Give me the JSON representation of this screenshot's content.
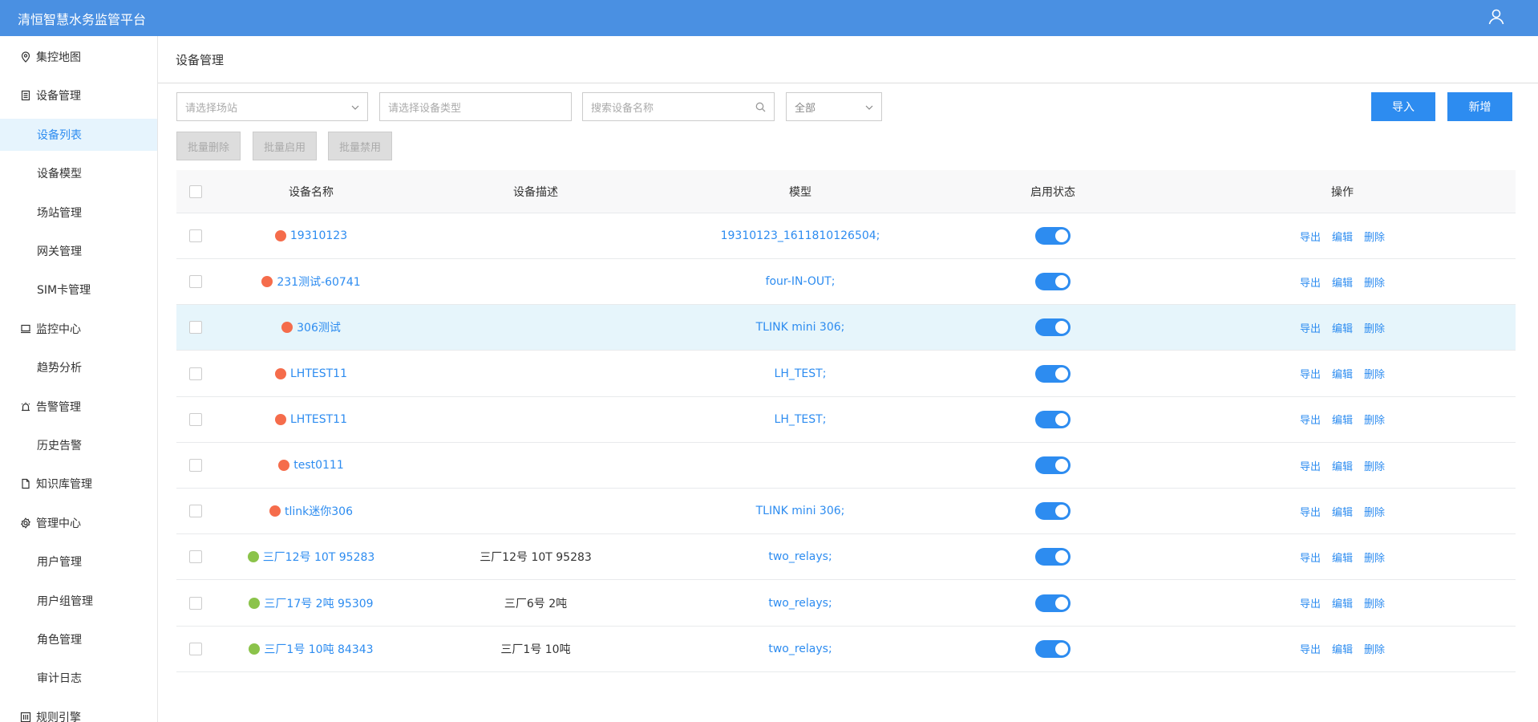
{
  "app": {
    "title": "清恒智慧水务监管平台"
  },
  "sidebar": {
    "items": [
      {
        "label": "集控地图",
        "level": "top",
        "icon": "map-pin-icon",
        "active": false
      },
      {
        "label": "设备管理",
        "level": "top",
        "icon": "device-list-icon",
        "active": false
      },
      {
        "label": "设备列表",
        "level": "sub",
        "active": true
      },
      {
        "label": "设备模型",
        "level": "sub",
        "active": false
      },
      {
        "label": "场站管理",
        "level": "sub",
        "active": false
      },
      {
        "label": "网关管理",
        "level": "sub",
        "active": false
      },
      {
        "label": "SIM卡管理",
        "level": "sub",
        "active": false
      },
      {
        "label": "监控中心",
        "level": "top",
        "icon": "monitor-icon",
        "active": false
      },
      {
        "label": "趋势分析",
        "level": "sub",
        "active": false
      },
      {
        "label": "告警管理",
        "level": "top",
        "icon": "alarm-icon",
        "active": false
      },
      {
        "label": "历史告警",
        "level": "sub",
        "active": false
      },
      {
        "label": "知识库管理",
        "level": "top",
        "icon": "document-icon",
        "active": false
      },
      {
        "label": "管理中心",
        "level": "top",
        "icon": "gear-icon",
        "active": false
      },
      {
        "label": "用户管理",
        "level": "sub",
        "active": false
      },
      {
        "label": "用户组管理",
        "level": "sub",
        "active": false
      },
      {
        "label": "角色管理",
        "level": "sub",
        "active": false
      },
      {
        "label": "审计日志",
        "level": "sub",
        "active": false
      },
      {
        "label": "规则引擎",
        "level": "top",
        "icon": "rules-icon",
        "active": false
      }
    ]
  },
  "page": {
    "title": "设备管理"
  },
  "filters": {
    "station_placeholder": "请选择场站",
    "type_placeholder": "请选择设备类型",
    "search_placeholder": "搜索设备名称",
    "status_value": "全部"
  },
  "buttons": {
    "import": "导入",
    "add": "新增",
    "batch_delete": "批量删除",
    "batch_enable": "批量启用",
    "batch_disable": "批量禁用"
  },
  "table": {
    "columns": [
      "设备名称",
      "设备描述",
      "模型",
      "启用状态",
      "操作"
    ],
    "ops": [
      "导出",
      "编辑",
      "删除"
    ],
    "rows": [
      {
        "name": "19310123",
        "desc": "",
        "model": "19310123_1611810126504;",
        "status_color": "#f56c4b",
        "enabled": true,
        "highlighted": false
      },
      {
        "name": "231测试-60741",
        "desc": "",
        "model": "four-IN-OUT;",
        "status_color": "#f56c4b",
        "enabled": true,
        "highlighted": false
      },
      {
        "name": "306测试",
        "desc": "",
        "model": "TLINK mini 306;",
        "status_color": "#f56c4b",
        "enabled": true,
        "highlighted": true
      },
      {
        "name": "LHTEST11",
        "desc": "",
        "model": "LH_TEST;",
        "status_color": "#f56c4b",
        "enabled": true,
        "highlighted": false
      },
      {
        "name": "LHTEST11",
        "desc": "",
        "model": "LH_TEST;",
        "status_color": "#f56c4b",
        "enabled": true,
        "highlighted": false
      },
      {
        "name": "test0111",
        "desc": "",
        "model": "",
        "status_color": "#f56c4b",
        "enabled": true,
        "highlighted": false
      },
      {
        "name": "tlink迷你306",
        "desc": "",
        "model": "TLINK mini 306;",
        "status_color": "#f56c4b",
        "enabled": true,
        "highlighted": false
      },
      {
        "name": "三厂12号 10T 95283",
        "desc": "三厂12号 10T 95283",
        "model": "two_relays;",
        "status_color": "#8bc34a",
        "enabled": true,
        "highlighted": false
      },
      {
        "name": "三厂17号 2吨 95309",
        "desc": "三厂6号 2吨",
        "model": "two_relays;",
        "status_color": "#8bc34a",
        "enabled": true,
        "highlighted": false
      },
      {
        "name": "三厂1号 10吨 84343",
        "desc": "三厂1号 10吨",
        "model": "two_relays;",
        "status_color": "#8bc34a",
        "enabled": true,
        "highlighted": false
      }
    ]
  }
}
